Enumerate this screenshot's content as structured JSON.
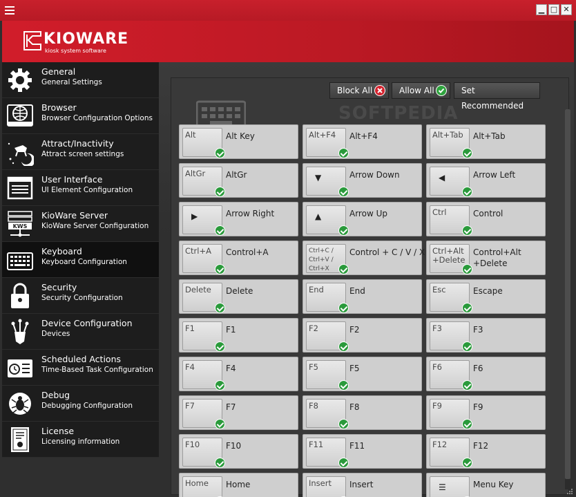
{
  "window": {
    "minimize": "▁",
    "maximize": "□",
    "close": "✕"
  },
  "brand": {
    "logo_text": "KIOWARE",
    "tagline": "kiosk system software",
    "trademark": "®"
  },
  "sidebar": {
    "items": [
      {
        "title": "General",
        "subtitle": "General Settings",
        "icon": "gear-icon"
      },
      {
        "title": "Browser",
        "subtitle": "Browser Configuration Options",
        "icon": "globe-browser-icon"
      },
      {
        "title": "Attract/Inactivity",
        "subtitle": "Attract screen settings",
        "icon": "moon-cow-icon"
      },
      {
        "title": "User Interface",
        "subtitle": "UI Element Configuration",
        "icon": "window-icon"
      },
      {
        "title": "KioWare Server",
        "subtitle": "KioWare Server Configuration",
        "icon": "server-icon",
        "badge": "KWS"
      },
      {
        "title": "Keyboard",
        "subtitle": "Keyboard Configuration",
        "icon": "keyboard-icon"
      },
      {
        "title": "Security",
        "subtitle": "Security Configuration",
        "icon": "lock-icon"
      },
      {
        "title": "Device Configuration",
        "subtitle": "Devices",
        "icon": "device-icon"
      },
      {
        "title": "Scheduled Actions",
        "subtitle": "Time-Based Task Configuration",
        "icon": "clock-list-icon"
      },
      {
        "title": "Debug",
        "subtitle": "Debugging Configuration",
        "icon": "bug-icon"
      },
      {
        "title": "License",
        "subtitle": "Licensing information",
        "icon": "certificate-icon"
      }
    ],
    "active_index": 5
  },
  "toolbar": {
    "block_all": "Block All",
    "allow_all": "Allow All",
    "set_recommended": "Set Recommended"
  },
  "watermark": "SOFTPEDIA",
  "keys": [
    {
      "key": "Alt",
      "label": "Alt Key"
    },
    {
      "key": "Alt+F4",
      "label": "Alt+F4"
    },
    {
      "key": "Alt+Tab",
      "label": "Alt+Tab"
    },
    {
      "key": "AltGr",
      "label": "AltGr"
    },
    {
      "key": "▼",
      "label": "Arrow Down"
    },
    {
      "key": "◀",
      "label": "Arrow Left"
    },
    {
      "key": "▶",
      "label": "Arrow Right"
    },
    {
      "key": "▲",
      "label": "Arrow Up"
    },
    {
      "key": "Ctrl",
      "label": "Control"
    },
    {
      "key": "Ctrl+A",
      "label": "Control+A"
    },
    {
      "key": "Ctrl+C /\nCtrl+V /\nCtrl+X",
      "label": "Control + C / V / X"
    },
    {
      "key": "Ctrl+Alt\n+Delete",
      "label": "Control+Alt\n+Delete"
    },
    {
      "key": "Delete",
      "label": "Delete"
    },
    {
      "key": "End",
      "label": "End"
    },
    {
      "key": "Esc",
      "label": "Escape"
    },
    {
      "key": "F1",
      "label": "F1"
    },
    {
      "key": "F2",
      "label": "F2"
    },
    {
      "key": "F3",
      "label": "F3"
    },
    {
      "key": "F4",
      "label": "F4"
    },
    {
      "key": "F5",
      "label": "F5"
    },
    {
      "key": "F6",
      "label": "F6"
    },
    {
      "key": "F7",
      "label": "F7"
    },
    {
      "key": "F8",
      "label": "F8"
    },
    {
      "key": "F9",
      "label": "F9"
    },
    {
      "key": "F10",
      "label": "F10"
    },
    {
      "key": "F11",
      "label": "F11"
    },
    {
      "key": "F12",
      "label": "F12"
    },
    {
      "key": "Home",
      "label": "Home"
    },
    {
      "key": "Insert",
      "label": "Insert"
    },
    {
      "key": "☰",
      "label": "Menu Key"
    }
  ],
  "colors": {
    "brand_red": "#c8202c",
    "allowed_green": "#2a9a3b",
    "blocked_red": "#d4232e"
  }
}
